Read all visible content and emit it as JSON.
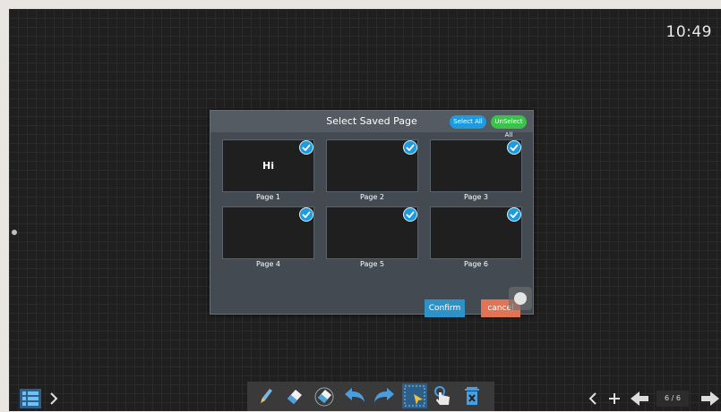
{
  "clock": "10:49",
  "dialog": {
    "title": "Select Saved Page",
    "select_all_label": "Select All",
    "unselect_all_label": "UnSelect All",
    "pages": [
      {
        "label": "Page 1",
        "content": "Hi",
        "checked": true
      },
      {
        "label": "Page 2",
        "content": "",
        "checked": true
      },
      {
        "label": "Page 3",
        "content": "",
        "checked": true
      },
      {
        "label": "Page 4",
        "content": "",
        "checked": true
      },
      {
        "label": "Page 5",
        "content": "",
        "checked": true
      },
      {
        "label": "Page 6",
        "content": "",
        "checked": true
      }
    ],
    "confirm_label": "Confirm",
    "cancel_label": "cancel"
  },
  "toolbar": {
    "left": [
      "menu-grid-icon",
      "chevron-right-icon"
    ],
    "center": [
      "pen-icon",
      "eraser-icon",
      "area-eraser-icon",
      "undo-icon",
      "redo-icon",
      "select-icon",
      "hand-icon",
      "trash-icon"
    ],
    "right": [
      "prev-page-icon",
      "add-page-icon",
      "back-arrow-icon",
      "forward-arrow-icon"
    ],
    "page_indicator": "6 / 6"
  },
  "colors": {
    "accent_blue": "#1e9bdf",
    "accent_green": "#3bc24b",
    "confirm": "#2f92c7",
    "cancel": "#e07455",
    "background": "#1f1f1f"
  }
}
